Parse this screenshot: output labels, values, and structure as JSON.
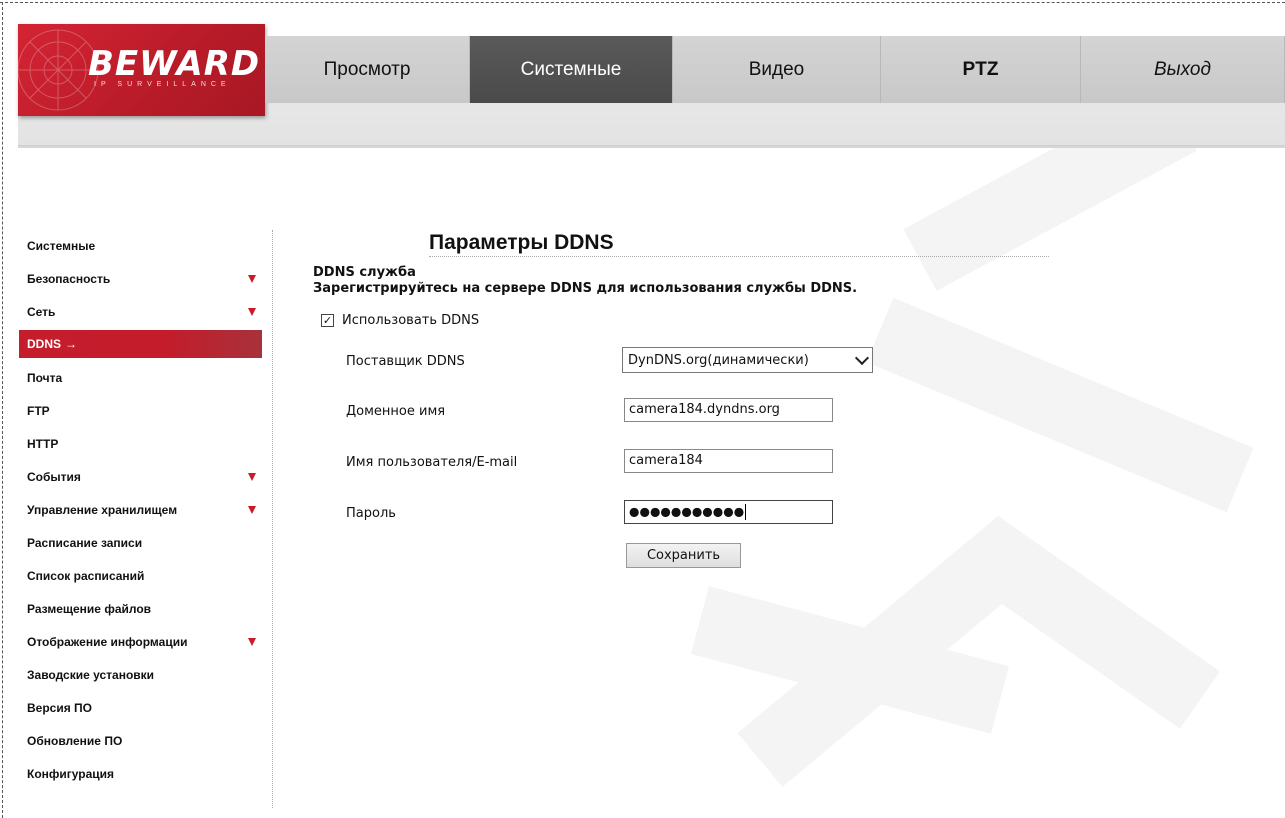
{
  "logo": {
    "brand": "BEWARD",
    "sub": "IP SURVEILLANCE"
  },
  "nav": {
    "tabs": [
      {
        "label": "Просмотр",
        "active": false
      },
      {
        "label": "Системные",
        "active": true
      },
      {
        "label": "Видео",
        "active": false
      },
      {
        "label": "PTZ",
        "active": false
      },
      {
        "label": "Выход",
        "active": false
      }
    ]
  },
  "sidebar": {
    "items": [
      {
        "label": "Системные",
        "expandable": false
      },
      {
        "label": "Безопасность",
        "expandable": true
      },
      {
        "label": "Сеть",
        "expandable": true
      },
      {
        "label": "DDNS",
        "active": true,
        "arrow": "→"
      },
      {
        "label": "Почта",
        "expandable": false
      },
      {
        "label": "FTP",
        "expandable": false
      },
      {
        "label": "HTTP",
        "expandable": false
      },
      {
        "label": "События",
        "expandable": true
      },
      {
        "label": "Управление хранилищем",
        "expandable": true
      },
      {
        "label": "Расписание записи",
        "expandable": false
      },
      {
        "label": "Список расписаний",
        "expandable": false
      },
      {
        "label": "Размещение файлов",
        "expandable": false
      },
      {
        "label": "Отображение информации",
        "expandable": true
      },
      {
        "label": "Заводские установки",
        "expandable": false
      },
      {
        "label": "Версия ПО",
        "expandable": false
      },
      {
        "label": "Обновление ПО",
        "expandable": false
      },
      {
        "label": "Конфигурация",
        "expandable": false
      }
    ]
  },
  "main": {
    "title": "Параметры DDNS",
    "section_heading": "DDNS служба",
    "section_description": "Зарегистрируйтесь на сервере DDNS для использования службы DDNS.",
    "use_ddns": {
      "label": "Использовать DDNS",
      "checked": true,
      "check_glyph": "✓"
    },
    "provider": {
      "label": "Поставщик DDNS",
      "value": "DynDNS.org(динамически)"
    },
    "domain": {
      "label": "Доменное имя",
      "value": "camera184.dyndns.org"
    },
    "username": {
      "label": "Имя пользователя/E-mail",
      "value": "camera184"
    },
    "password": {
      "label": "Пароль",
      "masked_value": "●●●●●●●●●●●"
    },
    "save_label": "Сохранить"
  },
  "colors": {
    "accent_red": "#c51d2c",
    "active_tab": "#4f4f4f"
  }
}
